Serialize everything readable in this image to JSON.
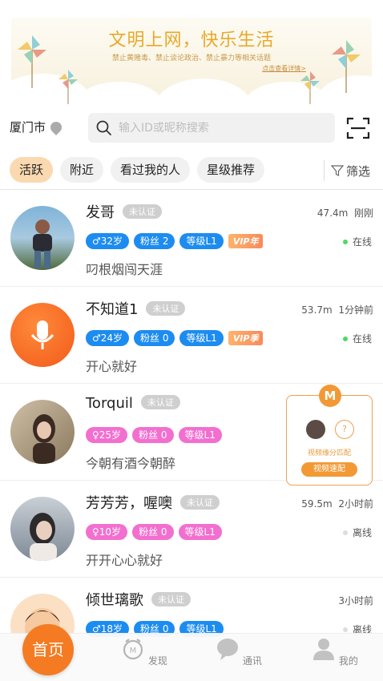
{
  "banner": {
    "title": "文明上网，快乐生活",
    "subtitle": "禁止黄赌毒、禁止谈论政治、禁止暴力等相关话题",
    "link": "点击查看详情>"
  },
  "location": {
    "city": "厦门市"
  },
  "search": {
    "placeholder": "输入ID或昵称搜索"
  },
  "tabs": [
    {
      "label": "活跃",
      "active": true
    },
    {
      "label": "附近",
      "active": false
    },
    {
      "label": "看过我的人",
      "active": false
    },
    {
      "label": "星级推荐",
      "active": false
    }
  ],
  "filter_label": "筛选",
  "users": [
    {
      "name": "发哥",
      "verify": "未认证",
      "distance": "47.4m",
      "time": "刚刚",
      "gender_age": "♂32岁",
      "fans": "粉丝 2",
      "level": "等级L1",
      "vip": "VIP年",
      "status": "在线",
      "online": true,
      "bio": "叼根烟闯天涯",
      "gender_color": "blue"
    },
    {
      "name": "不知道1",
      "verify": "未认证",
      "distance": "53.7m",
      "time": "1分钟前",
      "gender_age": "♂24岁",
      "fans": "粉丝 0",
      "level": "等级L1",
      "vip": "VIP季",
      "status": "在线",
      "online": true,
      "bio": "开心就好",
      "gender_color": "blue"
    },
    {
      "name": "Torquil",
      "verify": "未认证",
      "distance": "",
      "time": "",
      "gender_age": "♀25岁",
      "fans": "粉丝 0",
      "level": "等级L1",
      "vip": "",
      "status": "",
      "online": false,
      "bio": "今朝有酒今朝醉",
      "gender_color": "pink"
    },
    {
      "name": "芳芳芳，喔噢",
      "verify": "未认证",
      "distance": "59.5m",
      "time": "2小时前",
      "gender_age": "♀10岁",
      "fans": "粉丝 0",
      "level": "等级L1",
      "vip": "",
      "status": "离线",
      "online": false,
      "bio": "开开心心就好",
      "gender_color": "pink"
    },
    {
      "name": "倾世璃歌",
      "verify": "未认证",
      "distance": "",
      "time": "3小时前",
      "gender_age": "♂18岁",
      "fans": "粉丝 0",
      "level": "等级L1",
      "vip": "",
      "status": "离线",
      "online": false,
      "bio": "",
      "gender_color": "blue"
    }
  ],
  "match_card": {
    "logo": "M",
    "question": "?",
    "text": "视频缘分匹配",
    "button": "视频速配"
  },
  "nav": {
    "home": "首页",
    "discover": "发现",
    "messages": "通讯",
    "mine": "我的"
  },
  "colors": {
    "accent": "#f47b22",
    "tag_blue": "#1c8cf0",
    "tag_pink": "#f26fcf",
    "online": "#4cd964"
  }
}
